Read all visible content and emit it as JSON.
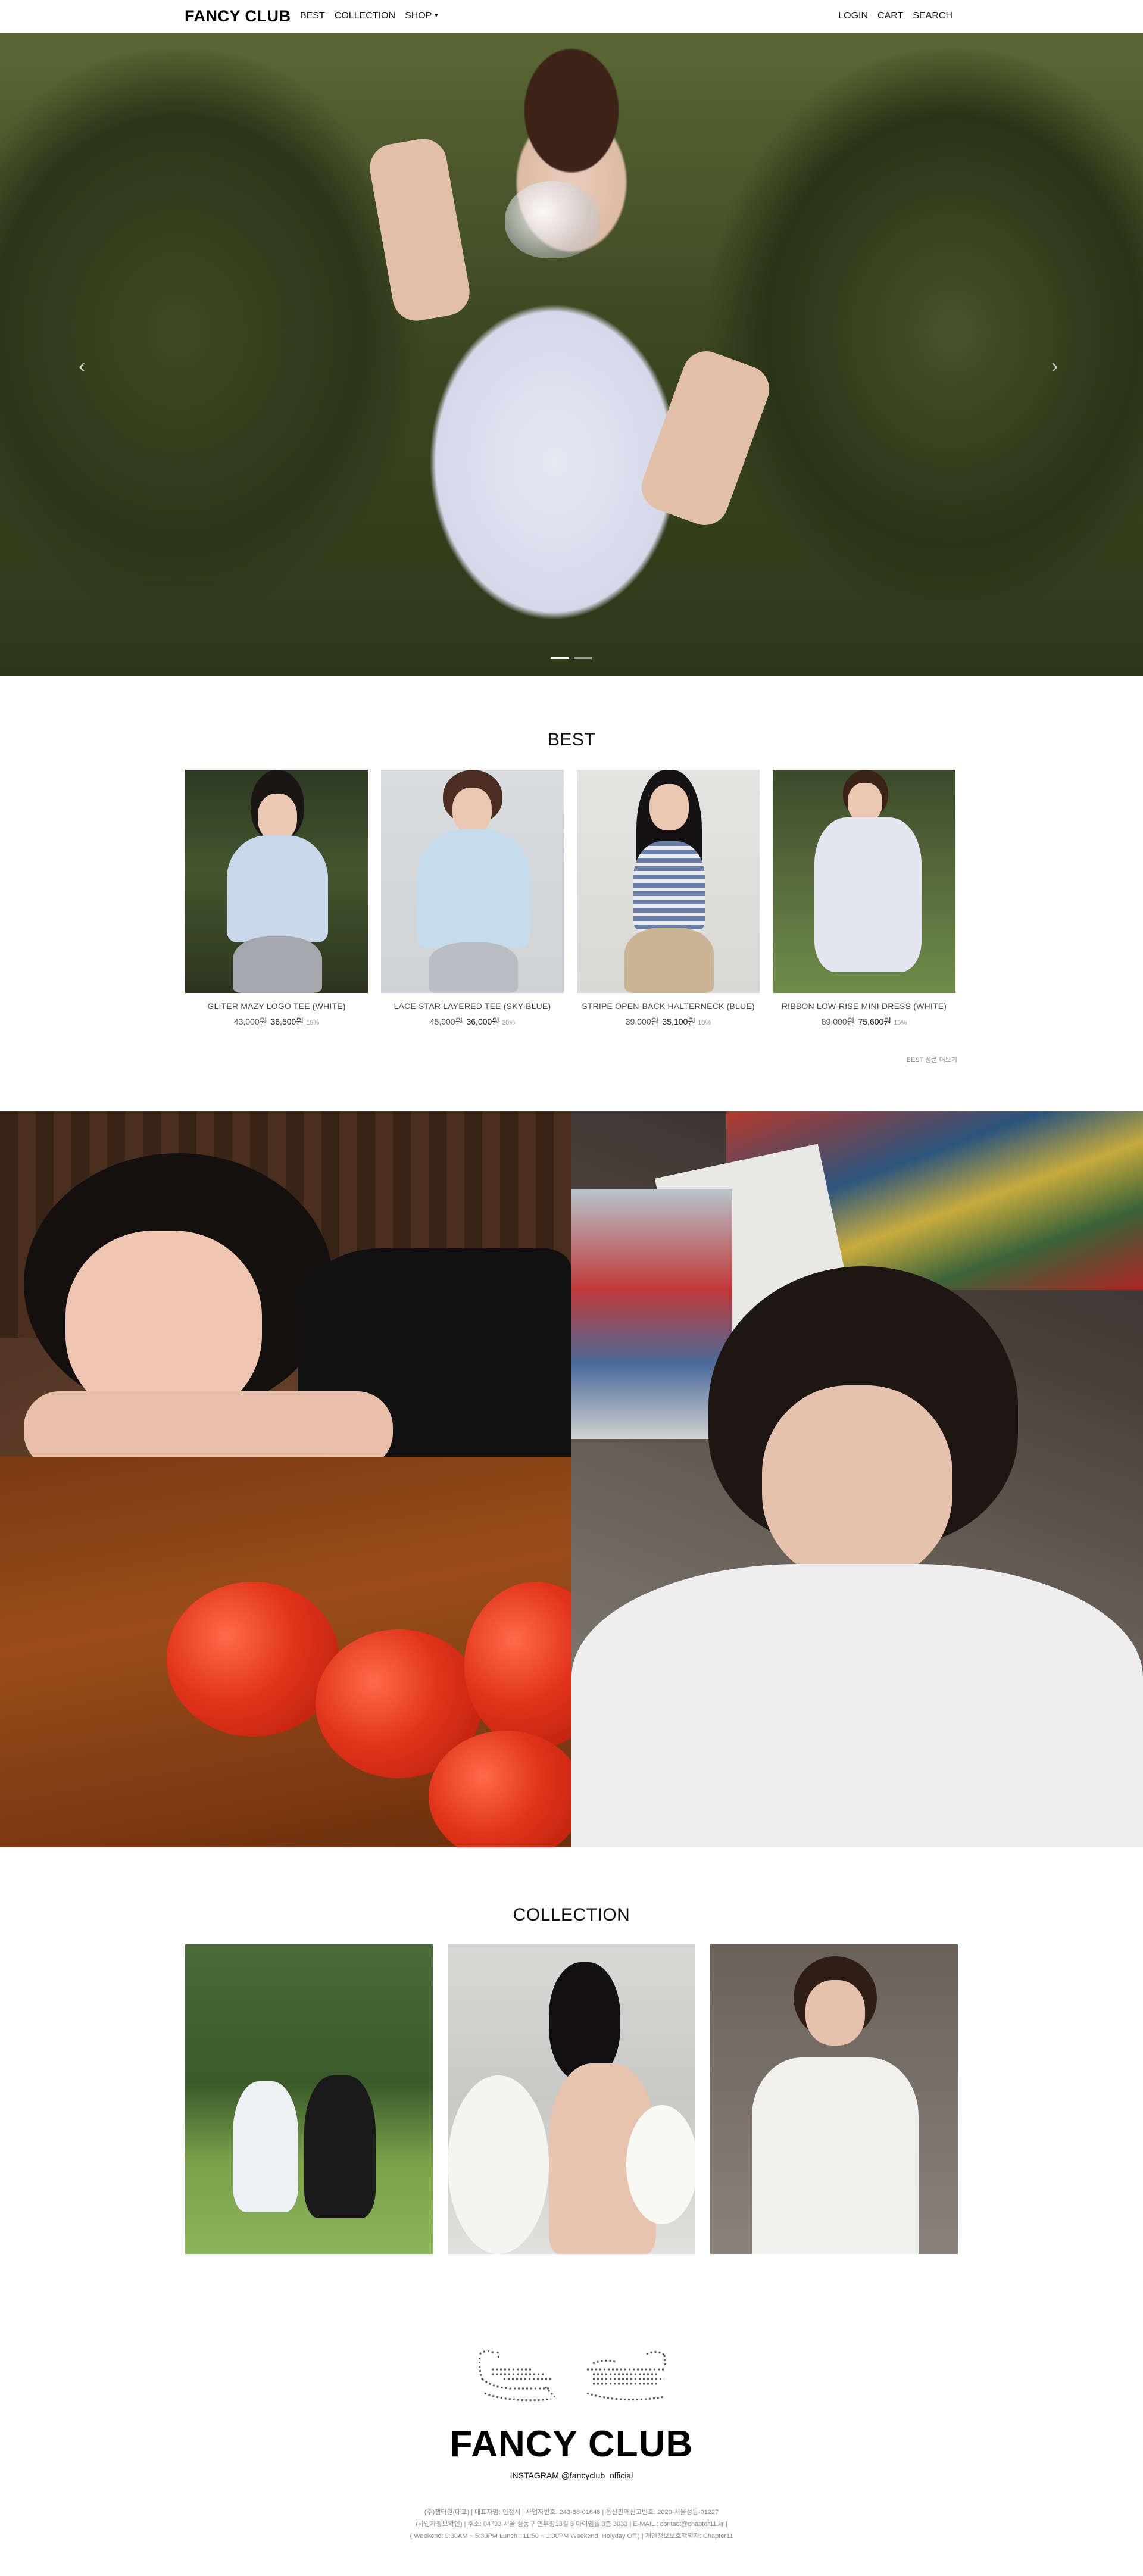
{
  "brand": "FANCY CLUB",
  "nav": {
    "left": [
      {
        "label": "BEST"
      },
      {
        "label": "COLLECTION"
      },
      {
        "label": "SHOP"
      }
    ],
    "right": [
      {
        "label": "LOGIN"
      },
      {
        "label": "CART"
      },
      {
        "label": "SEARCH"
      }
    ]
  },
  "hero": {
    "prev_icon": "‹",
    "next_icon": "›",
    "slide_count": 2,
    "active_slide": 1
  },
  "best": {
    "title": "BEST",
    "products": [
      {
        "name": "GLITER MAZY LOGO TEE (WHITE)",
        "original_price": "43,000원",
        "price": "36,500원",
        "discount": "15%"
      },
      {
        "name": "LACE STAR LAYERED TEE (SKY BLUE)",
        "original_price": "45,000원",
        "price": "36,000원",
        "discount": "20%"
      },
      {
        "name": "STRIPE OPEN-BACK HALTERNECK (BLUE)",
        "original_price": "39,000원",
        "price": "35,100원",
        "discount": "10%"
      },
      {
        "name": "RIBBON LOW-RISE MINI DRESS (WHITE)",
        "original_price": "89,000원",
        "price": "75,600원",
        "discount": "15%"
      }
    ],
    "more_link": "BEST 상품 더보기"
  },
  "collection": {
    "title": "COLLECTION"
  },
  "footer": {
    "logo": "FANCY CLUB",
    "instagram": "INSTAGRAM @fancyclub_official",
    "info_lines": [
      "(주)챕터원(대표) | 대표자명: 인정서 | 사업자번호: 243-88-01648 | 통신판매신고번호: 2020-서울성동-01227",
      "(사업자정보확인) | 주소: 04793 서울 성동구 연무장13길 8 아이엠홀 3층 3033 | E-MAIL : contact@chapter11.kr |",
      "( Weekend: 9:30AM ~ 5:30PM Lunch : 11:50 ~ 1:00PM Weekend, Holyday Off ) | 개인정보보호책임자: Chapter11"
    ]
  },
  "colors": {
    "text": "#111111",
    "muted": "#8a8a8a",
    "background": "#ffffff"
  }
}
